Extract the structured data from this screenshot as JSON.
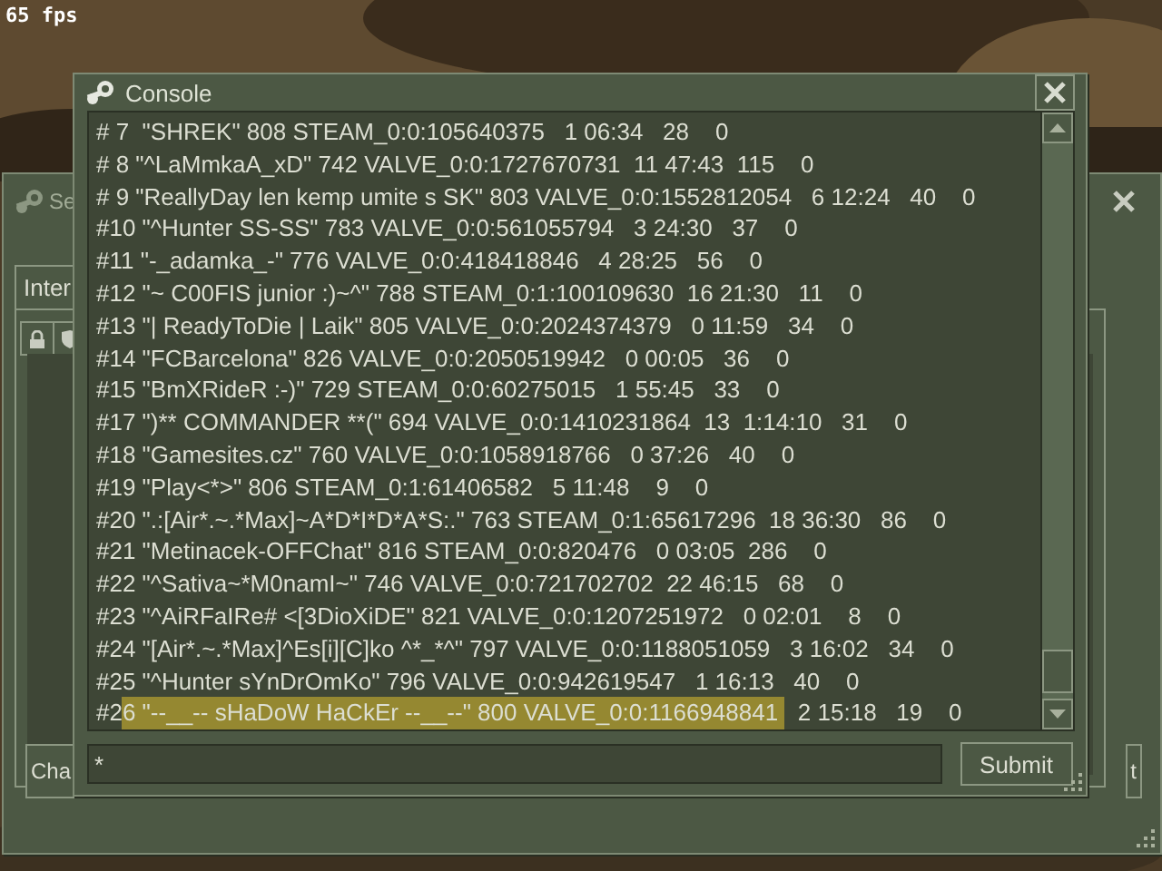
{
  "overlay": {
    "fps": "65 fps"
  },
  "background_window": {
    "title": "Se",
    "tab": "Inter",
    "left_button": "Cha",
    "right_button": "t"
  },
  "console": {
    "title": "Console",
    "lines": [
      {
        "segments": [
          {
            "text": "# 7  \"SHREK\" 808 STEAM_0:0:105640375   1 06:34   28    0",
            "selected": false
          }
        ]
      },
      {
        "segments": [
          {
            "text": "# 8 \"^LaMmkaA_xD\" 742 VALVE_0:0:1727670731  11 47:43  115    0",
            "selected": false
          }
        ]
      },
      {
        "segments": [
          {
            "text": "# 9 \"ReallyDay len kemp umite s SK\" 803 VALVE_0:0:1552812054   6 12:24   40    0",
            "selected": false
          }
        ]
      },
      {
        "segments": [
          {
            "text": "#10 \"^Hunter SS-SS\" 783 VALVE_0:0:561055794   3 24:30   37    0",
            "selected": false
          }
        ]
      },
      {
        "segments": [
          {
            "text": "#11 \"-_adamka_-\" 776 VALVE_0:0:418418846   4 28:25   56    0",
            "selected": false
          }
        ]
      },
      {
        "segments": [
          {
            "text": "#12 \"~ C00FIS junior :)~^\" 788 STEAM_0:1:100109630  16 21:30   11    0",
            "selected": false
          }
        ]
      },
      {
        "segments": [
          {
            "text": "#13 \"| ReadyToDie | Laik\" 805 VALVE_0:0:2024374379   0 11:59   34    0",
            "selected": false
          }
        ]
      },
      {
        "segments": [
          {
            "text": "#14 \"FCBarcelona\" 826 VALVE_0:0:2050519942   0 00:05   36    0",
            "selected": false
          }
        ]
      },
      {
        "segments": [
          {
            "text": "#15 \"BmXRideR :-)\" 729 STEAM_0:0:60275015   1 55:45   33    0",
            "selected": false
          }
        ]
      },
      {
        "segments": [
          {
            "text": "#17 \")** COMMANDER **(\" 694 VALVE_0:0:1410231864  13  1:14:10   31    0",
            "selected": false
          }
        ]
      },
      {
        "segments": [
          {
            "text": "#18 \"Gamesites.cz\" 760 VALVE_0:0:1058918766   0 37:26   40    0",
            "selected": false
          }
        ]
      },
      {
        "segments": [
          {
            "text": "#19 \"Play<*>\" 806 STEAM_0:1:61406582   5 11:48    9    0",
            "selected": false
          }
        ]
      },
      {
        "segments": [
          {
            "text": "#20 \".:[Air*.~.*Max]~A*D*I*D*A*S:.\" 763 STEAM_0:1:65617296  18 36:30   86    0",
            "selected": false
          }
        ]
      },
      {
        "segments": [
          {
            "text": "#21 \"Metinacek-OFFChat\" 816 STEAM_0:0:820476   0 03:05  286    0",
            "selected": false
          }
        ]
      },
      {
        "segments": [
          {
            "text": "#22 \"^Sativa~*M0namI~\" 746 VALVE_0:0:721702702  22 46:15   68    0",
            "selected": false
          }
        ]
      },
      {
        "segments": [
          {
            "text": "#23 \"^AiRFaIRe# <[3DioXiDE\" 821 VALVE_0:0:1207251972   0 02:01    8    0",
            "selected": false
          }
        ]
      },
      {
        "segments": [
          {
            "text": "#24 \"[Air*.~.*Max]^Es[i][C]ko ^*_*^\" 797 VALVE_0:0:1188051059   3 16:02   34    0",
            "selected": false
          }
        ]
      },
      {
        "segments": [
          {
            "text": "#25 \"^Hunter sYnDrOmKo\" 796 VALVE_0:0:942619547   1 16:13   40    0",
            "selected": false
          }
        ]
      },
      {
        "segments": [
          {
            "text": "#2",
            "selected": false
          },
          {
            "text": "6 \"--__-- sHaDoW HaCkEr --__--\" 800 VALVE_0:0:1166948841 ",
            "selected": true
          },
          {
            "text": "  2 15:18   19    0",
            "selected": false
          }
        ]
      }
    ],
    "input": {
      "value": "*"
    },
    "submit": "Submit"
  }
}
